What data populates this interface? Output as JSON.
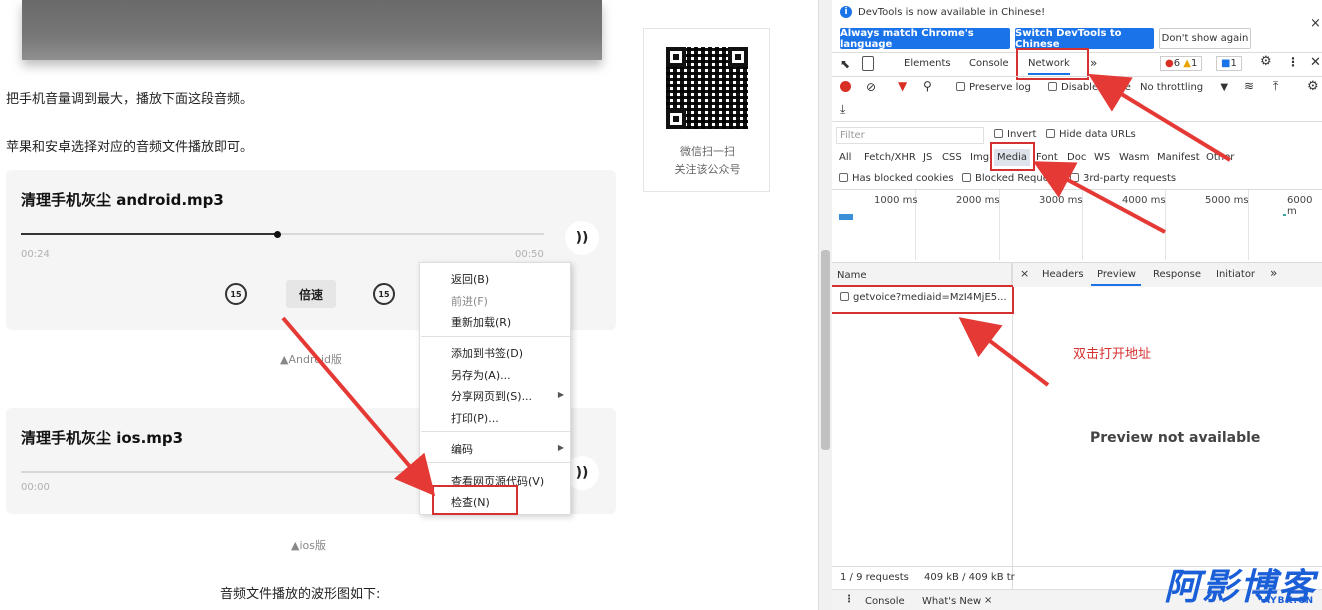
{
  "article": {
    "para1": "把手机音量调到最大，播放下面这段音频。",
    "para2": "苹果和安卓选择对应的音频文件播放即可。",
    "audio1": {
      "title": "清理手机灰尘 android.mp3",
      "current": "00:24",
      "duration": "00:50",
      "progress": 0.49,
      "speed_label": "倍速",
      "skip_back": "15",
      "skip_fwd": "15",
      "caption": "▲Android版"
    },
    "audio2": {
      "title": "清理手机灰尘 ios.mp3",
      "current": "00:00",
      "caption": "▲ios版"
    },
    "bottom_text": "音频文件播放的波形图如下:",
    "qr": {
      "line1": "微信扫一扫",
      "line2": "关注该公众号"
    }
  },
  "context_menu": {
    "items": [
      "返回(B)",
      "前进(F)",
      "重新加载(R)",
      "添加到书签(D)",
      "另存为(A)...",
      "分享网页到(S)...",
      "打印(P)...",
      "编码",
      "查看网页源代码(V)",
      "检查(N)"
    ]
  },
  "devtools": {
    "banner_text": "DevTools is now available in Chinese!",
    "btn_match": "Always match Chrome's language",
    "btn_switch": "Switch DevTools to Chinese",
    "btn_dont_show": "Don't show again",
    "close": "×",
    "tabs": [
      "Elements",
      "Console",
      "Network"
    ],
    "more_tabs": "»",
    "errors": "6",
    "warnings": "1",
    "messages": "1",
    "toolbar": {
      "preserve_log": "Preserve log",
      "disable_cache": "Disable cache",
      "throttling": "No throttling"
    },
    "filter_placeholder": "Filter",
    "invert": "Invert",
    "hide_data_urls": "Hide data URLs",
    "types": [
      "All",
      "Fetch/XHR",
      "JS",
      "CSS",
      "Img",
      "Media",
      "Font",
      "Doc",
      "WS",
      "Wasm",
      "Manifest",
      "Other"
    ],
    "has_blocked_cookies": "Has blocked cookies",
    "blocked_requests": "Blocked Requests",
    "third_party": "3rd-party requests",
    "timeline": [
      "1000 ms",
      "2000 ms",
      "3000 ms",
      "4000 ms",
      "5000 ms",
      "6000 m"
    ],
    "name_header": "Name",
    "request_name": "getvoice?mediaid=MzI4MjE5...",
    "detail_tabs": [
      "Headers",
      "Preview",
      "Response",
      "Initiator"
    ],
    "preview_msg": "Preview not available",
    "annotation": "双击打开地址",
    "status_requests": "1 / 9 requests",
    "status_size": "409 kB / 409 kB tr",
    "drawer_tabs": [
      "Console",
      "What's New"
    ]
  },
  "watermark": {
    "main": "阿影博客",
    "sub": "AYBK.CN"
  },
  "colors": {
    "accent": "#1a73e8",
    "annotation": "#d63131",
    "watermark": "#1a5fd8"
  }
}
